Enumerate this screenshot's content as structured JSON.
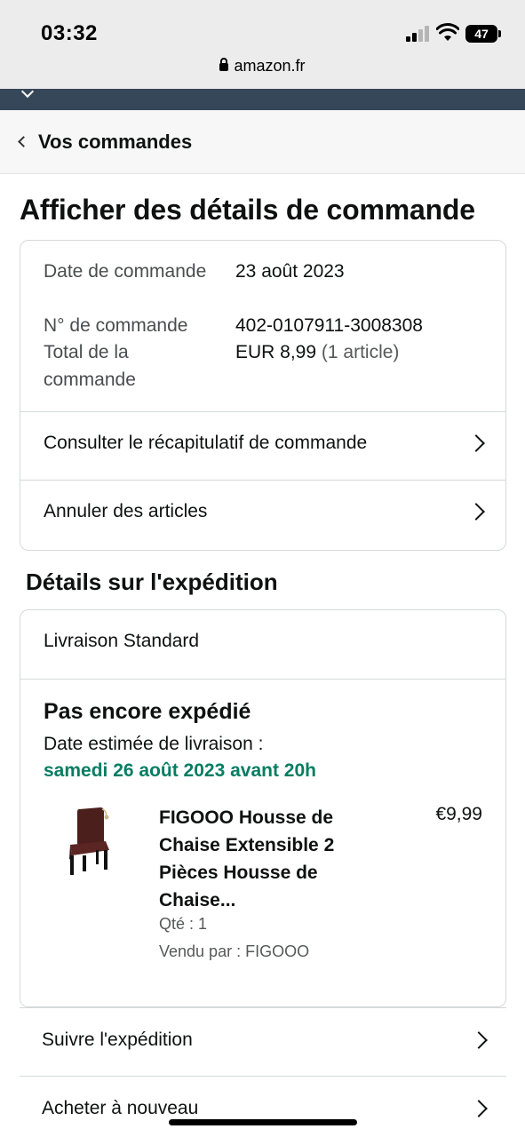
{
  "status_bar": {
    "time": "03:32",
    "battery": "47",
    "url": "amazon.fr"
  },
  "back_nav": {
    "label": "Vos commandes"
  },
  "page_title": "Afficher des détails de commande",
  "order_info": {
    "date_label": "Date de commande",
    "date_value": "23 août 2023",
    "number_label": "N° de commande",
    "number_value": "402-0107911-3008308",
    "total_label": "Total de la commande",
    "total_value": "EUR 8,99",
    "total_count": "(1 article)"
  },
  "order_actions": [
    {
      "label": "Consulter le récapitulatif de commande"
    },
    {
      "label": "Annuler des articles"
    }
  ],
  "shipping": {
    "section_title": "Détails sur l'expédition",
    "delivery_type": "Livraison Standard",
    "status": "Pas encore expédié",
    "estimate_label": "Date estimée de livraison :",
    "estimate_date": "samedi 26 août 2023 avant 20h",
    "item": {
      "title": "FIGOOO Housse de Chaise Extensible 2 Pièces Housse de Chaise...",
      "price": "€9,99",
      "qty": "Qté : 1",
      "seller": "Vendu par : FIGOOO"
    }
  },
  "bottom_actions": [
    {
      "label": "Suivre l'expédition"
    },
    {
      "label": "Acheter à nouveau"
    }
  ],
  "colors": {
    "green": "#067d62",
    "navbar": "#37475a"
  }
}
